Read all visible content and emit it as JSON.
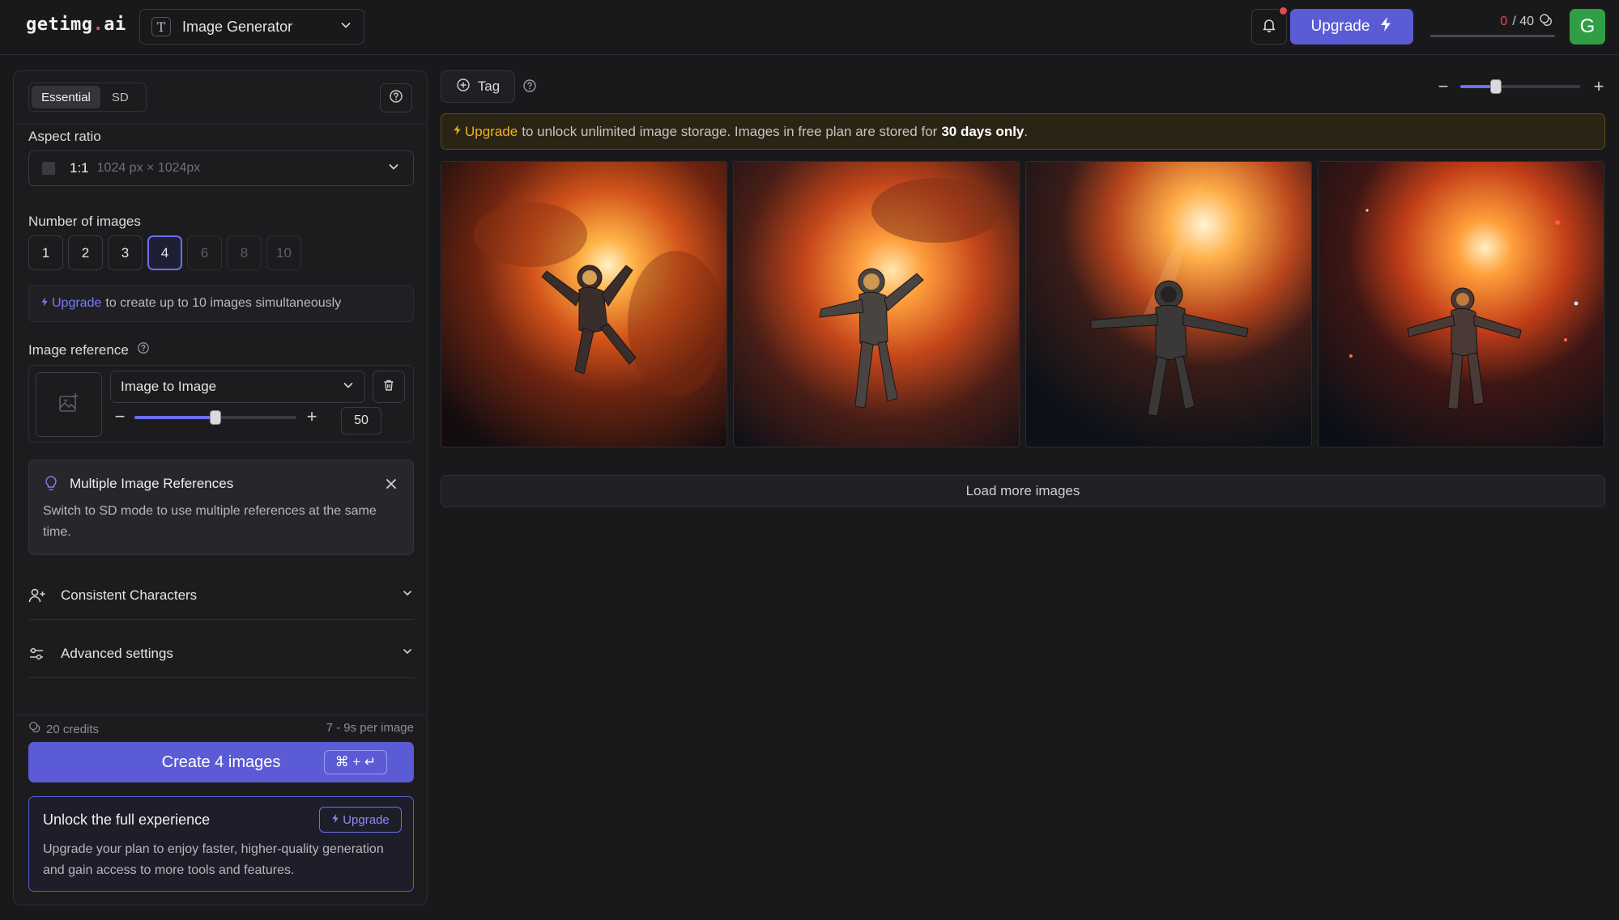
{
  "header": {
    "logo_main": "getimg",
    "logo_dot": ".",
    "logo_suffix": "ai",
    "tool_icon_letter": "T",
    "tool_label": "Image Generator",
    "upgrade_label": "Upgrade",
    "credits_used": "0",
    "credits_total": "/ 40",
    "avatar_letter": "G",
    "notification_dot": true
  },
  "panel": {
    "tabs": [
      {
        "label": "Essential",
        "active": true
      },
      {
        "label": "SD",
        "active": false
      }
    ],
    "aspect": {
      "label": "Aspect ratio",
      "ratio": "1:1",
      "dims": "1024 px × 1024px"
    },
    "num_images": {
      "label": "Number of images",
      "options": [
        "1",
        "2",
        "3",
        "4",
        "6",
        "8",
        "10"
      ],
      "selected": "4",
      "disabled": [
        "6",
        "8",
        "10"
      ],
      "upgrade_link": "Upgrade",
      "upgrade_text": "to create up to 10 images simultaneously"
    },
    "reference": {
      "label": "Image reference",
      "type": "Image to Image",
      "strength": "50",
      "strength_max": 100
    },
    "tip": {
      "title": "Multiple Image References",
      "text": "Switch to SD mode to use multiple references at the same time."
    },
    "accordions": {
      "characters": "Consistent Characters",
      "advanced": "Advanced settings"
    },
    "footer": {
      "credits": "20 credits",
      "time": "7 - 9s per image",
      "create_label": "Create 4 images",
      "shortcut": "⌘ + ↵"
    },
    "unlock": {
      "title": "Unlock the full experience",
      "button": "Upgrade",
      "text": "Upgrade your plan to enjoy faster, higher-quality generation and gain access to more tools and features."
    }
  },
  "main": {
    "tag_label": "Tag",
    "zoom_level": 0.3,
    "banner": {
      "link": "Upgrade",
      "text": "to unlock unlimited image storage. Images in free plan are stored for",
      "bold": "30 days only",
      "end": "."
    },
    "images": [
      {
        "subject": "astronaut floating in fiery nebula"
      },
      {
        "subject": "astronaut with raised arms in fiery nebula"
      },
      {
        "subject": "astronaut with arms outstretched, light rays"
      },
      {
        "subject": "astronaut floating among red stars"
      }
    ],
    "load_more": "Load more images"
  },
  "colors": {
    "accent": "#5b5bd6",
    "warning": "#f2b01e",
    "danger": "#e5484d",
    "avatar": "#2f9e44",
    "background": "#19191b"
  },
  "icons": [
    "bell-icon",
    "lightning-icon",
    "coins-icon",
    "chevron-down-icon",
    "help-circle-icon",
    "trash-icon",
    "image-plus-icon",
    "lightbulb-icon",
    "close-icon",
    "user-plus-icon",
    "sliders-icon",
    "plus-circle-icon"
  ]
}
